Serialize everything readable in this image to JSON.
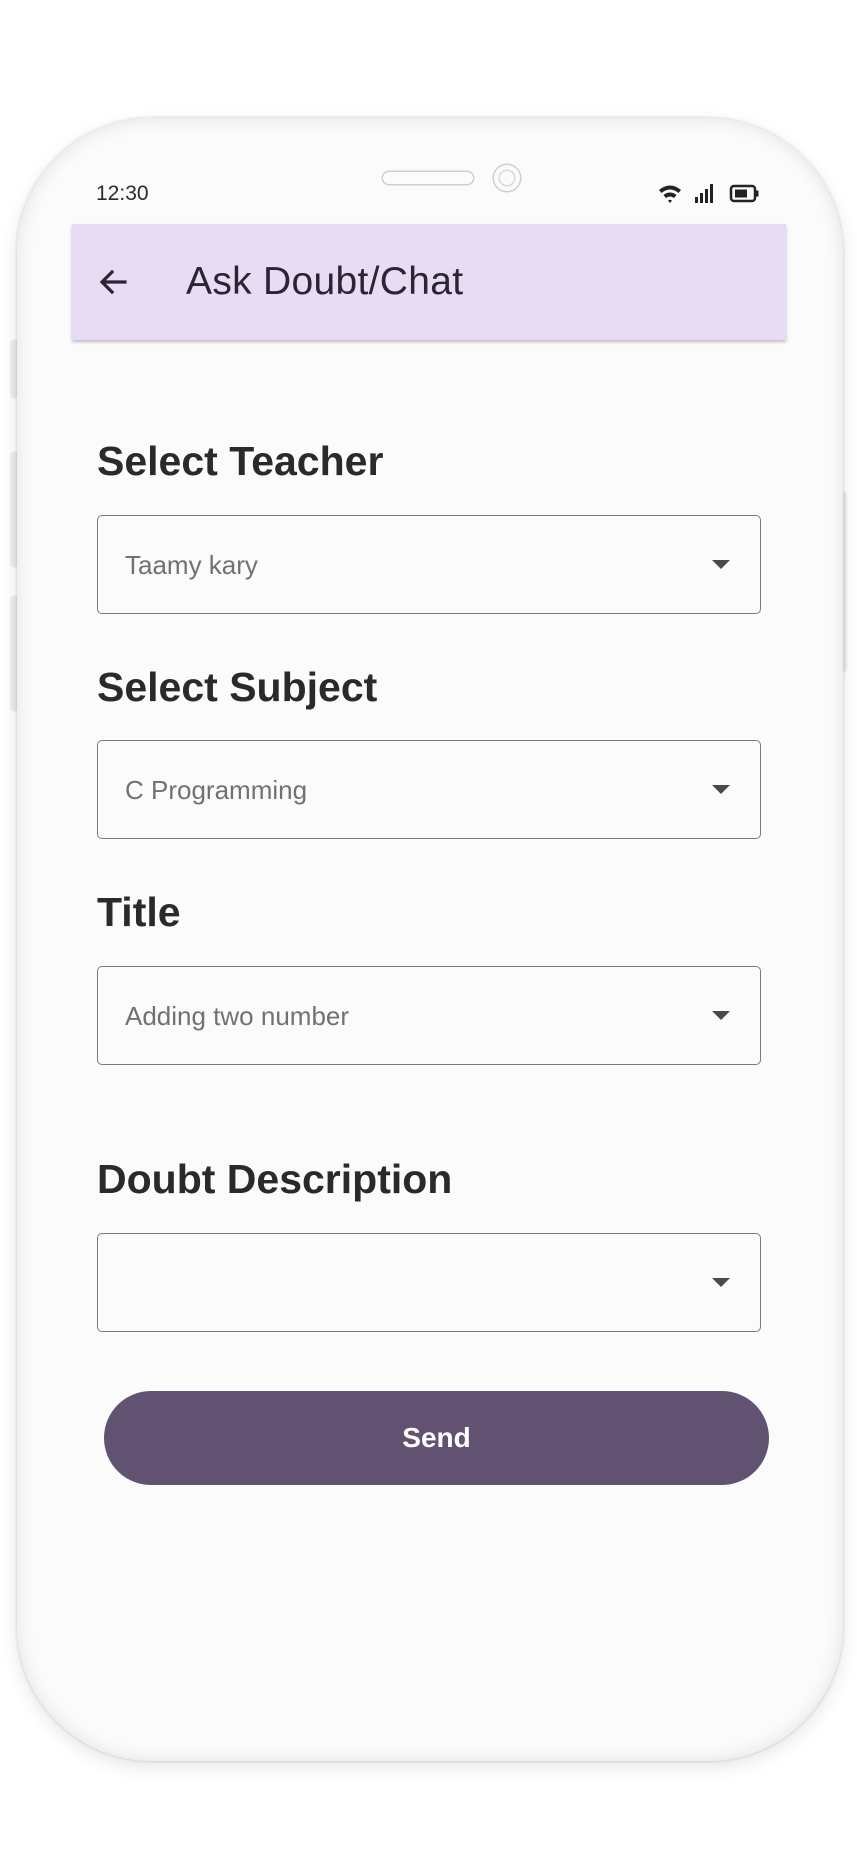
{
  "status_bar": {
    "time": "12:30",
    "icons": [
      "wifi-icon",
      "signal-icon",
      "battery-icon"
    ]
  },
  "app_bar": {
    "back_icon": "arrow-left-icon",
    "title": "Ask Doubt/Chat",
    "background": "#e7dcf4"
  },
  "form": {
    "teacher": {
      "label": "Select Teacher",
      "value": "Taamy kary"
    },
    "subject": {
      "label": "Select Subject",
      "value": "C Programming"
    },
    "title": {
      "label": "Title",
      "value": "Adding two number"
    },
    "description": {
      "label": "Doubt Description",
      "value": ""
    },
    "send_label": "Send"
  },
  "colors": {
    "accent": "#615272",
    "app_bar": "#e7dcf4",
    "text": "#2a2a2a"
  }
}
